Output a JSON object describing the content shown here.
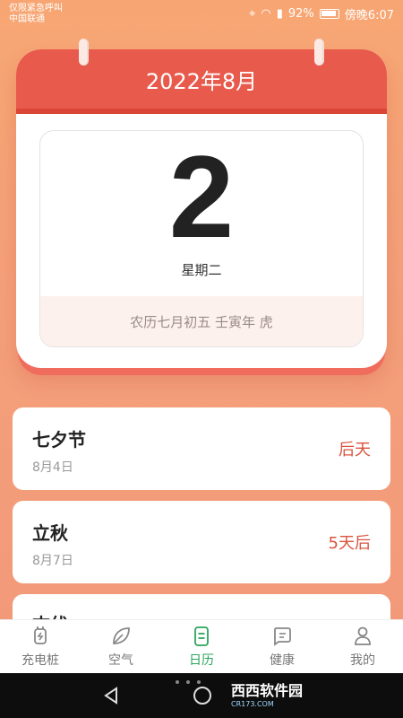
{
  "status_bar": {
    "carrier_line1": "仅限紧急呼叫",
    "carrier_line2": "中国联通",
    "battery": "92%",
    "time": "傍晚6:07"
  },
  "calendar": {
    "month_title": "2022年8月",
    "day": "2",
    "weekday": "星期二",
    "lunar": "农历七月初五 壬寅年 虎"
  },
  "events": [
    {
      "name": "七夕节",
      "date": "8月4日",
      "countdown": "后天"
    },
    {
      "name": "立秋",
      "date": "8月7日",
      "countdown": "5天后"
    },
    {
      "name": "末伏",
      "date": "",
      "countdown": ""
    }
  ],
  "tabs": [
    {
      "label": "充电桩",
      "icon": "plug-icon"
    },
    {
      "label": "空气",
      "icon": "leaf-icon"
    },
    {
      "label": "日历",
      "icon": "calendar-icon",
      "active": true
    },
    {
      "label": "健康",
      "icon": "health-icon"
    },
    {
      "label": "我的",
      "icon": "person-icon"
    }
  ],
  "watermark": {
    "main": "西西软件园",
    "sub": "CR173.COM"
  },
  "colors": {
    "accent": "#e85a4b",
    "active_tab": "#2aa55c",
    "countdown": "#d9543f"
  }
}
